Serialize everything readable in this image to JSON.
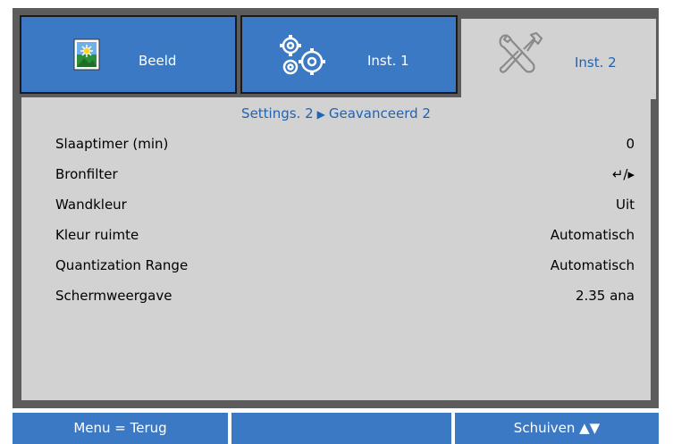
{
  "tabs": [
    {
      "label": "Beeld",
      "icon": "image-settings-icon",
      "active": false
    },
    {
      "label": "Inst. 1",
      "icon": "gears-icon",
      "active": false
    },
    {
      "label": "Inst. 2",
      "icon": "tools-icon",
      "active": true
    }
  ],
  "breadcrumb": {
    "parent": "Settings. 2",
    "separator_icon": "triangle-right-icon",
    "current": "Geavanceerd 2"
  },
  "menu": [
    {
      "label": "Slaaptimer (min)",
      "value": "0"
    },
    {
      "label": "Bronfilter",
      "value": "↵/▸"
    },
    {
      "label": "Wandkleur",
      "value": "Uit"
    },
    {
      "label": "Kleur ruimte",
      "value": "Automatisch"
    },
    {
      "label": "Quantization Range",
      "value": "Automatisch"
    },
    {
      "label": "Schermweergave",
      "value": "2.35 ana"
    }
  ],
  "footer": {
    "left": "Menu = Terug",
    "middle": "",
    "right": "Schuiven ▲▼"
  },
  "colors": {
    "tab_blue": "#3b79c4",
    "panel_gray": "#d2d2d2",
    "frame_gray": "#5c5c5c",
    "accent_text": "#1f63b6"
  }
}
